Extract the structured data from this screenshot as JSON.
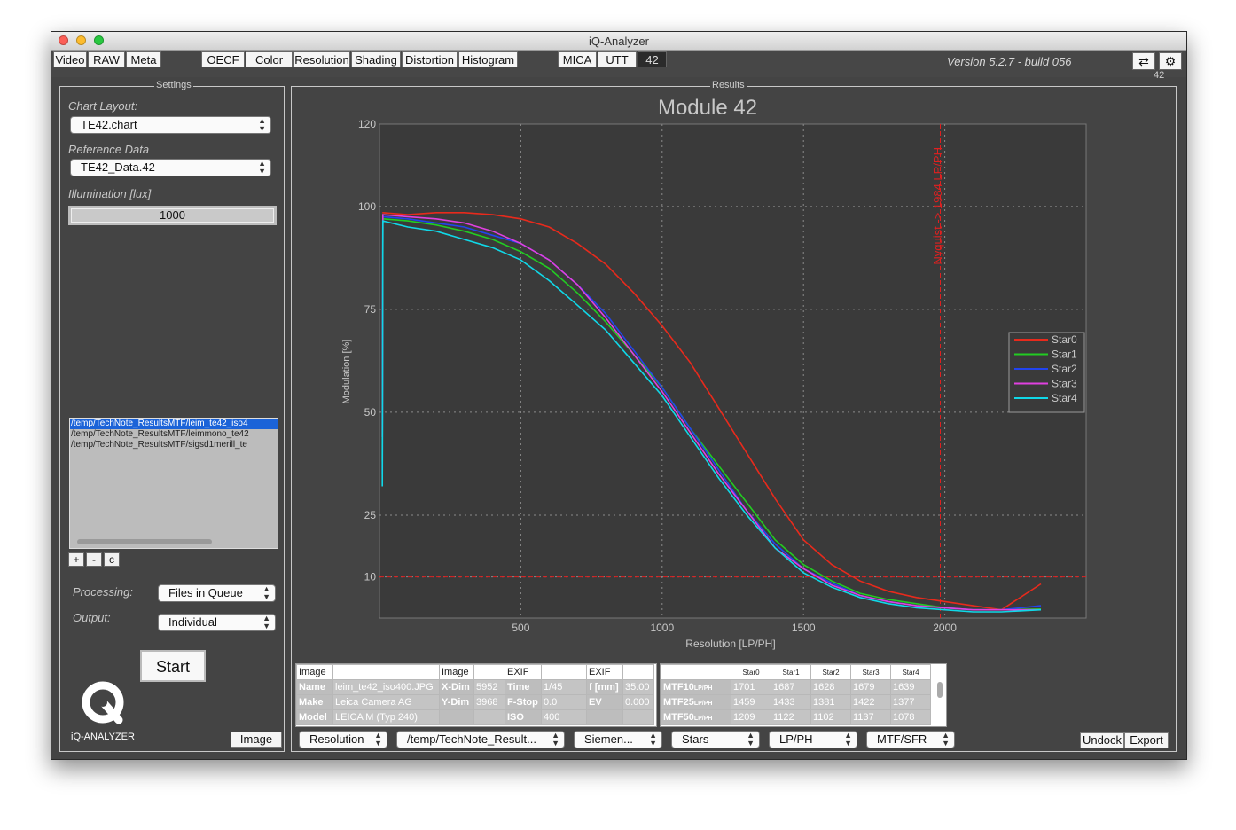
{
  "window": {
    "title": "iQ-Analyzer",
    "version": "Version 5.2.7 - build 056",
    "corner_label": "42"
  },
  "toolbar": {
    "group1": [
      "Video",
      "RAW",
      "Meta"
    ],
    "group2": [
      "OECF",
      "Color",
      "Resolution",
      "Shading",
      "Distortion",
      "Histogram"
    ],
    "group3": [
      "MICA",
      "UTT",
      "42"
    ],
    "active": "42",
    "icons": [
      "swap-icon",
      "gear-icon"
    ]
  },
  "settings": {
    "title": "Settings",
    "chart_layout_label": "Chart Layout:",
    "chart_layout_value": "TE42.chart",
    "reference_label": "Reference Data",
    "reference_value": "TE42_Data.42",
    "illumination_label": "Illumination [lux]",
    "illumination_value": "1000",
    "files": [
      "/temp/TechNote_ResultsMTF/leim_te42_iso4",
      "/temp/TechNote_ResultsMTF/leimmono_te42",
      "/temp/TechNote_ResultsMTF/sigsd1merill_te"
    ],
    "list_buttons": [
      "+",
      "-",
      "c"
    ],
    "processing_label": "Processing:",
    "processing_value": "Files in Queue",
    "output_label": "Output:",
    "output_value": "Individual",
    "start_label": "Start",
    "logo_text": "iQ-ANALYZER",
    "image_button": "Image"
  },
  "results": {
    "title": "Results",
    "chart_title": "Module 42",
    "nyquist_label": "Nyquist -> 1984 LP/PH"
  },
  "chart_data": {
    "type": "line",
    "title": "Module 42",
    "xlabel": "Resolution [LP/PH]",
    "ylabel": "Modulation [%]",
    "xlim": [
      0,
      2500
    ],
    "ylim": [
      0,
      120
    ],
    "x_ticks": [
      500,
      1000,
      1500,
      2000
    ],
    "y_ticks": [
      10,
      25,
      50,
      75,
      100,
      120
    ],
    "grid": true,
    "legend": "right",
    "reference_lines": [
      {
        "axis": "x",
        "value": 1984,
        "label": "Nyquist -> 1984 LP/PH",
        "color": "#e02020"
      },
      {
        "axis": "y",
        "value": 10,
        "color": "#e02020"
      }
    ],
    "series": [
      {
        "name": "Star0",
        "color": "#e82a1c",
        "x": [
          10,
          100,
          200,
          300,
          400,
          500,
          600,
          700,
          800,
          900,
          1000,
          1100,
          1200,
          1300,
          1400,
          1500,
          1600,
          1700,
          1800,
          1900,
          2000,
          2100,
          2200,
          2340
        ],
        "y": [
          98.5,
          98,
          98.5,
          98.5,
          98,
          97,
          95,
          91,
          86,
          79,
          71,
          62,
          51,
          40,
          29,
          19,
          13,
          9,
          6.5,
          5,
          4,
          3,
          2,
          8.3
        ]
      },
      {
        "name": "Star1",
        "color": "#22cc22",
        "x": [
          10,
          12,
          100,
          200,
          300,
          400,
          500,
          600,
          700,
          800,
          900,
          1000,
          1100,
          1200,
          1300,
          1400,
          1500,
          1600,
          1700,
          1800,
          1900,
          2000,
          2100,
          2200,
          2340
        ],
        "y": [
          38,
          97,
          96.5,
          95.5,
          94,
          92,
          89,
          85,
          79,
          72,
          64,
          56,
          46,
          37,
          28,
          19,
          13,
          9,
          6,
          4.5,
          3.5,
          2.5,
          2,
          2,
          2.2
        ]
      },
      {
        "name": "Star2",
        "color": "#2244ee",
        "x": [
          10,
          12,
          100,
          200,
          300,
          400,
          500,
          600,
          700,
          800,
          900,
          1000,
          1100,
          1200,
          1300,
          1400,
          1500,
          1600,
          1700,
          1800,
          1900,
          2000,
          2100,
          2200,
          2340
        ],
        "y": [
          35,
          97.5,
          97,
          96,
          95,
          93,
          91,
          87,
          81,
          74,
          65,
          56,
          46,
          36,
          26,
          18,
          12,
          8.5,
          5.5,
          4,
          3,
          2.5,
          2,
          2,
          3
        ]
      },
      {
        "name": "Star3",
        "color": "#e040e0",
        "x": [
          10,
          12,
          100,
          200,
          300,
          400,
          500,
          600,
          700,
          800,
          900,
          1000,
          1100,
          1200,
          1300,
          1400,
          1500,
          1600,
          1700,
          1800,
          1900,
          2000,
          2100,
          2200,
          2340
        ],
        "y": [
          44,
          98,
          97.5,
          97,
          96,
          94,
          91,
          87,
          81,
          73,
          64,
          55,
          45,
          35,
          26,
          17,
          12,
          8,
          5.5,
          4,
          3,
          2.5,
          2,
          2,
          2
        ]
      },
      {
        "name": "Star4",
        "color": "#10d8e8",
        "x": [
          10,
          12,
          100,
          200,
          300,
          400,
          500,
          600,
          700,
          800,
          900,
          1000,
          1100,
          1200,
          1300,
          1400,
          1500,
          1600,
          1700,
          1800,
          1900,
          2000,
          2100,
          2200,
          2340
        ],
        "y": [
          32,
          96.5,
          95,
          94,
          92,
          90,
          87,
          82,
          76,
          70,
          62,
          54,
          44,
          34,
          25,
          17,
          11,
          7.5,
          5,
          3.5,
          2.5,
          2,
          1.5,
          1.5,
          2
        ]
      }
    ]
  },
  "image_table": {
    "headers": [
      "Image",
      "",
      "Image",
      "",
      "EXIF",
      "",
      "EXIF",
      ""
    ],
    "rows": [
      [
        "Name",
        "leim_te42_iso400.JPG",
        "X-Dim",
        "5952",
        "Time",
        "1/45",
        "f [mm]",
        "35.00"
      ],
      [
        "Make",
        "Leica Camera AG",
        "Y-Dim",
        "3968",
        "F-Stop",
        "0.0",
        "EV",
        "0.000"
      ],
      [
        "Model",
        "LEICA M (Typ 240)",
        "",
        "",
        "ISO",
        "400",
        "",
        ""
      ]
    ]
  },
  "mtf_table": {
    "headers": [
      "",
      "Star0",
      "Star1",
      "Star2",
      "Star3",
      "Star4"
    ],
    "rows": [
      [
        "MTF10",
        "1701",
        "1687",
        "1628",
        "1679",
        "1639"
      ],
      [
        "MTF25",
        "1459",
        "1433",
        "1381",
        "1422",
        "1377"
      ],
      [
        "MTF50",
        "1209",
        "1122",
        "1102",
        "1137",
        "1078"
      ]
    ],
    "row_unit": "LP/PH"
  },
  "bottom_bar": {
    "selects": [
      "Resolution",
      "/temp/TechNote_Result...",
      "Siemen...",
      "Stars",
      "LP/PH",
      "MTF/SFR"
    ],
    "undock": "Undock",
    "export": "Export"
  }
}
